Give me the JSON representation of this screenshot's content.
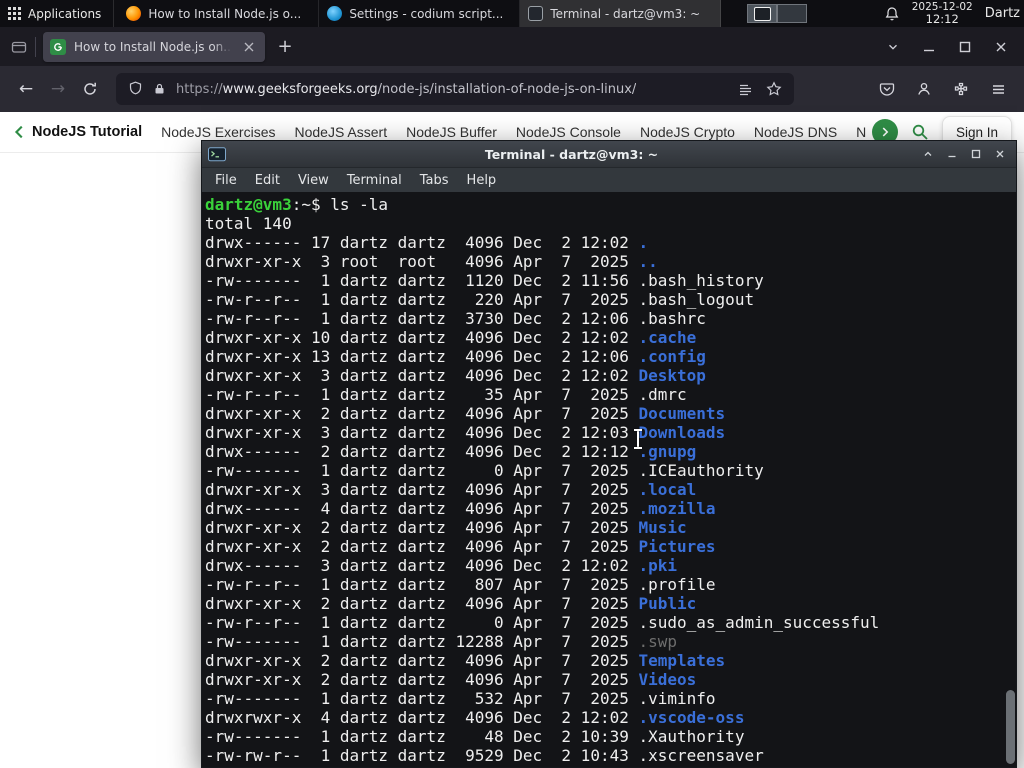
{
  "colors": {
    "gfg_green": "#2f8d46",
    "terminal_prompt_green": "#3ad23a",
    "terminal_dir_blue": "#3a6fd8",
    "terminal_fg": "#efefef",
    "terminal_dim": "#6e6e6e"
  },
  "panel": {
    "applications_label": "Applications",
    "tasks": [
      {
        "title": "How to Install Node.js o...",
        "icon": "firefox-icon",
        "active": false
      },
      {
        "title": "Settings - codium script...",
        "icon": "codium-icon",
        "active": false
      },
      {
        "title": "Terminal - dartz@vm3: ~",
        "icon": "terminal-task-icon",
        "active": true
      }
    ],
    "clock_date": "2025-12-02",
    "clock_time": "12:12",
    "user_label": "Dartz"
  },
  "browser": {
    "tab_title": "How to Install Node.js on...",
    "new_tab_label": "+",
    "url_prefix": "https://",
    "url_domain": "www.geeksforgeeks.org",
    "url_path": "/node-js/installation-of-node-js-on-linux/"
  },
  "gfg_nav": {
    "links": [
      {
        "label": "NodeJS Tutorial",
        "bold": true
      },
      {
        "label": "NodeJS Exercises",
        "bold": false
      },
      {
        "label": "NodeJS Assert",
        "bold": false
      },
      {
        "label": "NodeJS Buffer",
        "bold": false
      },
      {
        "label": "NodeJS Console",
        "bold": false
      },
      {
        "label": "NodeJS Crypto",
        "bold": false
      },
      {
        "label": "NodeJS DNS",
        "bold": false
      },
      {
        "label": "Node",
        "bold": false
      }
    ],
    "sign_in_label": "Sign In"
  },
  "terminal": {
    "title": "Terminal - dartz@vm3: ~",
    "menu_items": [
      "File",
      "Edit",
      "View",
      "Terminal",
      "Tabs",
      "Help"
    ],
    "prompt": {
      "user_host": "dartz@vm3",
      "separator": ":~$",
      "command": " ls -la"
    },
    "output": [
      {
        "pre": "total 140"
      },
      {
        "pre": "drwx------ 17 dartz dartz  4096 Dec  2 12:02 ",
        "name": ".",
        "type": "dir"
      },
      {
        "pre": "drwxr-xr-x  3 root  root   4096 Apr  7  2025 ",
        "name": "..",
        "type": "dir"
      },
      {
        "pre": "-rw-------  1 dartz dartz  1120 Dec  2 11:56 ",
        "name": ".bash_history",
        "type": ""
      },
      {
        "pre": "-rw-r--r--  1 dartz dartz   220 Apr  7  2025 ",
        "name": ".bash_logout",
        "type": ""
      },
      {
        "pre": "-rw-r--r--  1 dartz dartz  3730 Dec  2 12:06 ",
        "name": ".bashrc",
        "type": ""
      },
      {
        "pre": "drwxr-xr-x 10 dartz dartz  4096 Dec  2 12:02 ",
        "name": ".cache",
        "type": "dir"
      },
      {
        "pre": "drwxr-xr-x 13 dartz dartz  4096 Dec  2 12:06 ",
        "name": ".config",
        "type": "dir"
      },
      {
        "pre": "drwxr-xr-x  3 dartz dartz  4096 Dec  2 12:02 ",
        "name": "Desktop",
        "type": "dir"
      },
      {
        "pre": "-rw-r--r--  1 dartz dartz    35 Apr  7  2025 ",
        "name": ".dmrc",
        "type": ""
      },
      {
        "pre": "drwxr-xr-x  2 dartz dartz  4096 Apr  7  2025 ",
        "name": "Documents",
        "type": "dir"
      },
      {
        "pre": "drwxr-xr-x  3 dartz dartz  4096 Dec  2 12:03 ",
        "name": "Downloads",
        "type": "dir"
      },
      {
        "pre": "drwx------  2 dartz dartz  4096 Dec  2 12:12 ",
        "name": ".gnupg",
        "type": "dir"
      },
      {
        "pre": "-rw-------  1 dartz dartz     0 Apr  7  2025 ",
        "name": ".ICEauthority",
        "type": ""
      },
      {
        "pre": "drwxr-xr-x  3 dartz dartz  4096 Apr  7  2025 ",
        "name": ".local",
        "type": "dir"
      },
      {
        "pre": "drwx------  4 dartz dartz  4096 Apr  7  2025 ",
        "name": ".mozilla",
        "type": "dir"
      },
      {
        "pre": "drwxr-xr-x  2 dartz dartz  4096 Apr  7  2025 ",
        "name": "Music",
        "type": "dir"
      },
      {
        "pre": "drwxr-xr-x  2 dartz dartz  4096 Apr  7  2025 ",
        "name": "Pictures",
        "type": "dir"
      },
      {
        "pre": "drwx------  3 dartz dartz  4096 Dec  2 12:02 ",
        "name": ".pki",
        "type": "dir"
      },
      {
        "pre": "-rw-r--r--  1 dartz dartz   807 Apr  7  2025 ",
        "name": ".profile",
        "type": ""
      },
      {
        "pre": "drwxr-xr-x  2 dartz dartz  4096 Apr  7  2025 ",
        "name": "Public",
        "type": "dir"
      },
      {
        "pre": "-rw-r--r--  1 dartz dartz     0 Apr  7  2025 ",
        "name": ".sudo_as_admin_successful",
        "type": ""
      },
      {
        "pre": "-rw-------  1 dartz dartz 12288 Apr  7  2025 ",
        "name": ".swp",
        "type": "dim"
      },
      {
        "pre": "drwxr-xr-x  2 dartz dartz  4096 Apr  7  2025 ",
        "name": "Templates",
        "type": "dir"
      },
      {
        "pre": "drwxr-xr-x  2 dartz dartz  4096 Apr  7  2025 ",
        "name": "Videos",
        "type": "dir"
      },
      {
        "pre": "-rw-------  1 dartz dartz   532 Apr  7  2025 ",
        "name": ".viminfo",
        "type": ""
      },
      {
        "pre": "drwxrwxr-x  4 dartz dartz  4096 Dec  2 12:02 ",
        "name": ".vscode-oss",
        "type": "dir"
      },
      {
        "pre": "-rw-------  1 dartz dartz    48 Dec  2 10:39 ",
        "name": ".Xauthority",
        "type": ""
      },
      {
        "pre": "-rw-rw-r--  1 dartz dartz  9529 Dec  2 10:43 ",
        "name": ".xscreensaver",
        "type": ""
      }
    ]
  }
}
